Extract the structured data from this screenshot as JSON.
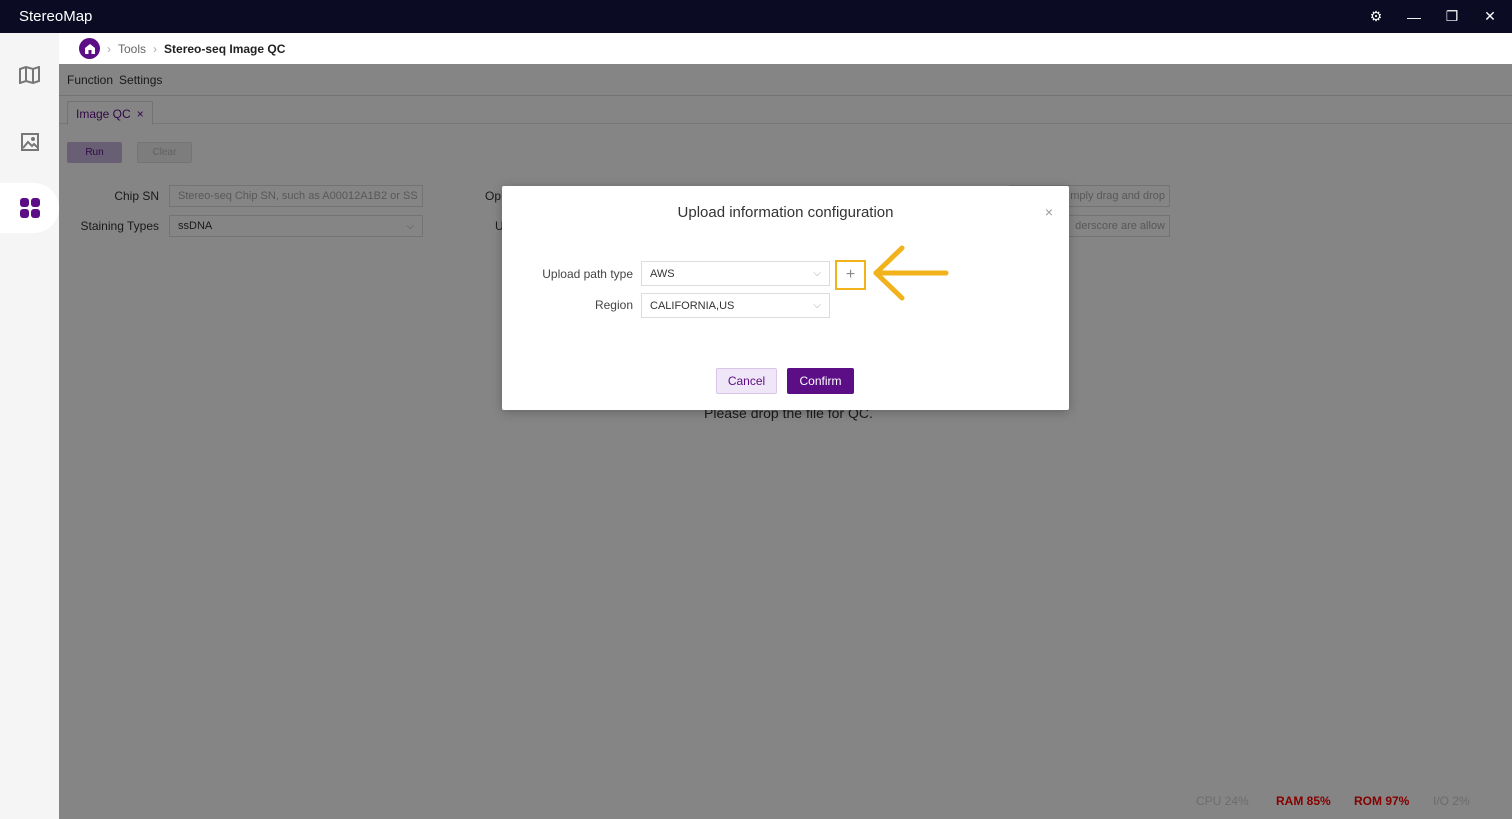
{
  "app": {
    "title": "StereoMap"
  },
  "window_controls": [
    "settings-icon",
    "minimize-icon",
    "restore-icon",
    "close-icon"
  ],
  "sidebar": {
    "items": [
      {
        "name": "map-icon",
        "active": false
      },
      {
        "name": "image-icon",
        "active": false
      },
      {
        "name": "tools-grid-icon",
        "active": true
      }
    ]
  },
  "breadcrumb": {
    "items": [
      "Tools",
      "Stereo-seq Image QC"
    ]
  },
  "menu": {
    "items": [
      "Function",
      "Settings"
    ]
  },
  "tabs": [
    {
      "label": "Image QC",
      "close": "×"
    }
  ],
  "toolbar": {
    "run_label": "Run",
    "clear_label": "Clear"
  },
  "form": {
    "chip_sn_label": "Chip SN",
    "chip_sn_placeholder": "Stereo-seq Chip SN, such as A00012A1B2 or SS",
    "staining_label": "Staining Types",
    "staining_value": "ssDNA",
    "op_label_partial": "Op",
    "u_label_partial": "U",
    "right_input_1": "mply drag and drop",
    "right_input_2": "derscore are allow"
  },
  "drop_hint": "Please drop the file for QC.",
  "status_bar": {
    "cpu": "CPU  24%",
    "ram": "RAM  85%",
    "rom": "ROM  97%",
    "io": "I/O  2%"
  },
  "modal": {
    "title": "Upload information configuration",
    "close": "×",
    "upload_path_label": "Upload path type",
    "upload_path_value": "AWS",
    "region_label": "Region",
    "region_value": "CALIFORNIA,US",
    "add_symbol": "+",
    "cancel_label": "Cancel",
    "confirm_label": "Confirm"
  },
  "colors": {
    "brand": "#5b0e85",
    "titlebar": "#0b0b24",
    "highlight": "#f2b21b",
    "alert": "#ff0000"
  }
}
